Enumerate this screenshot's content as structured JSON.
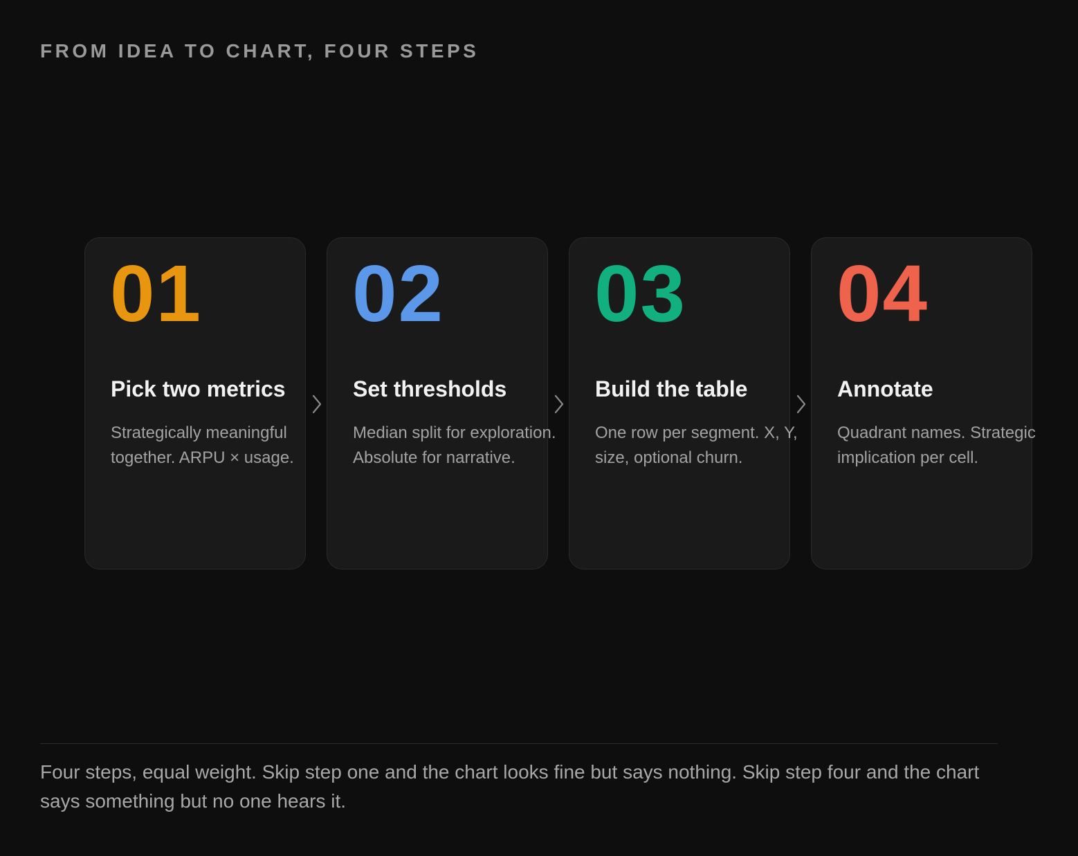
{
  "header": {
    "eyebrow": "FROM IDEA TO CHART, FOUR STEPS"
  },
  "steps": [
    {
      "number": "01",
      "title": "Pick two metrics",
      "description": "Strategically meaningful together. ARPU × usage.",
      "color": "#e8960f"
    },
    {
      "number": "02",
      "title": "Set thresholds",
      "description": "Median split for exploration. Absolute for narrative.",
      "color": "#5b98ea"
    },
    {
      "number": "03",
      "title": "Build the table",
      "description": "One row per segment. X, Y, size, optional churn.",
      "color": "#12b07f"
    },
    {
      "number": "04",
      "title": "Annotate",
      "description": "Quadrant names. Strategic implication per cell.",
      "color": "#ef624b"
    }
  ],
  "connector": {
    "icon": "chevron-right-icon",
    "color": "#8a8a8a"
  },
  "footer": {
    "caption": "Four steps, equal weight. Skip step one and the chart looks fine but says nothing. Skip step four and the chart says something but no one hears it."
  }
}
